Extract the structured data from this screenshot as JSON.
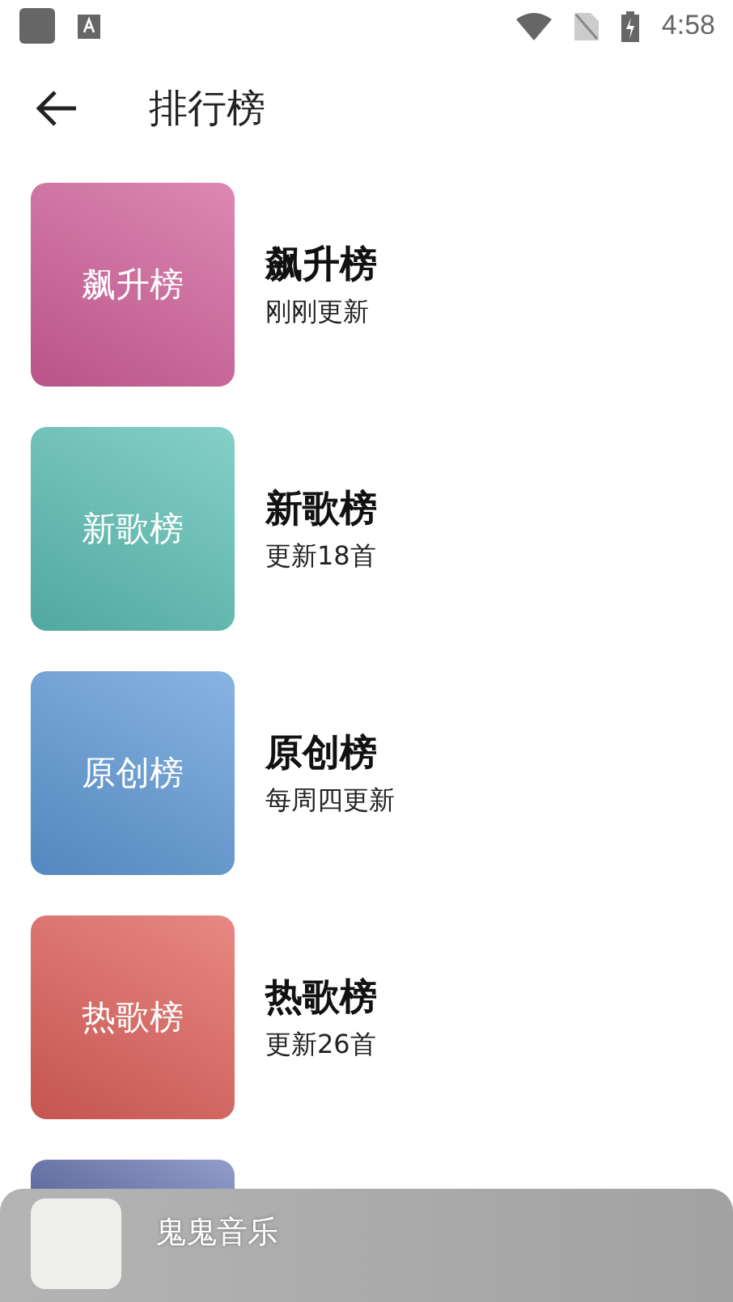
{
  "status_bar": {
    "time": "4:58"
  },
  "header": {
    "title": "排行榜"
  },
  "charts": [
    {
      "cover_label": "飙升榜",
      "title": "飙升榜",
      "subtitle": "刚刚更新",
      "color": "#d2609a"
    },
    {
      "cover_label": "新歌榜",
      "title": "新歌榜",
      "subtitle": "更新18首",
      "color": "#5cc0b5"
    },
    {
      "cover_label": "原创榜",
      "title": "原创榜",
      "subtitle": "每周四更新",
      "color": "#5f9ad8"
    },
    {
      "cover_label": "热歌榜",
      "title": "热歌榜",
      "subtitle": "更新26首",
      "color": "#e0605a"
    },
    {
      "color": "#6f7cb7"
    }
  ],
  "player": {
    "song": "鬼鬼音乐"
  }
}
